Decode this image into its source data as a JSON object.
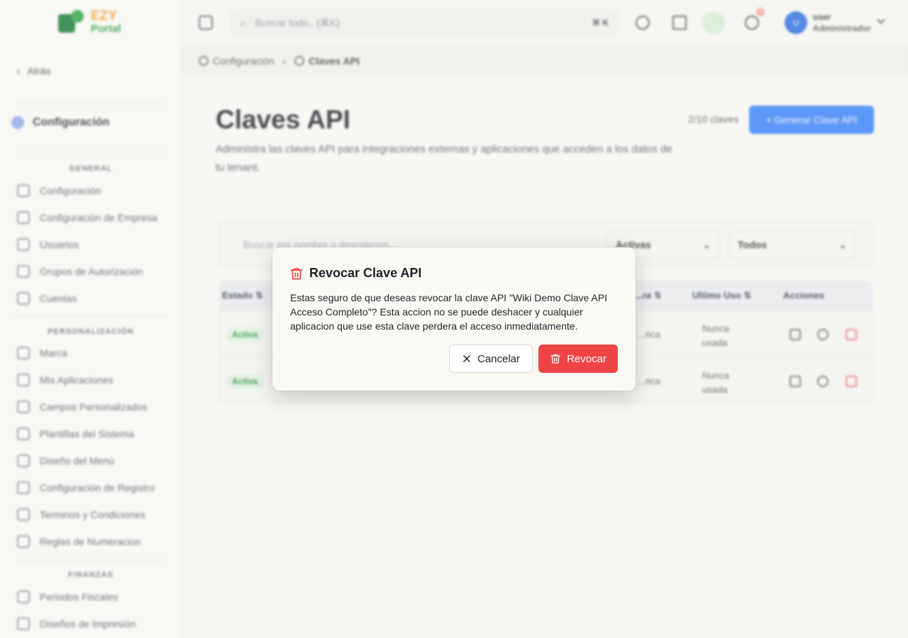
{
  "brand": {
    "line1": "EZY",
    "line2": "Portal"
  },
  "sidebar": {
    "back_label": "Atrás",
    "section_title": "Configuración",
    "groups": [
      {
        "label": "GENERAL",
        "items": [
          "Configuración",
          "Configuración de Empresa",
          "Usuarios",
          "Grupos de Autorización",
          "Cuentas"
        ]
      },
      {
        "label": "PERSONALIZACIÓN",
        "items": [
          "Marca",
          "Mis Aplicaciones",
          "Campos Personalizados",
          "Plantillas del Sistema",
          "Diseño del Menú",
          "Configuración de Registro",
          "Terminos y Condiciones",
          "Reglas de Numeracion"
        ]
      },
      {
        "label": "FINANZAS",
        "items": [
          "Periodos Fiscales",
          "Diseños de Impresión"
        ]
      }
    ]
  },
  "topbar": {
    "search_placeholder": "Buscar todo.. (⌘K)",
    "shortcut": "⌘ K",
    "notification_count": "2",
    "avatar_initial": "U",
    "user_name": "user",
    "user_role": "Administrador"
  },
  "breadcrumb": {
    "parent": "Configuración",
    "current": "Claves API"
  },
  "page": {
    "title": "Claves API",
    "description": "Administra las claves API para integraciones externas y aplicaciones que acceden a los datos de tu tenant.",
    "count": "2/10 claves",
    "generate_label": "+ Generar Clave API"
  },
  "filters": {
    "search_placeholder": "Buscar por nombre o descripcion...",
    "status": "Activas",
    "scope": "Todos"
  },
  "table": {
    "headers": [
      "Estado",
      "...ra",
      "Ultimo Uso",
      "Acciones"
    ],
    "rows": [
      {
        "status": "Activa",
        "expiry": "...nca",
        "last_use": "Nunca usada"
      },
      {
        "status": "Activa",
        "expiry": "...nca",
        "last_use": "Nunca usada"
      }
    ]
  },
  "modal": {
    "title": "Revocar Clave API",
    "body": "Estas seguro de que deseas revocar la clave API \"Wiki Demo Clave API Acceso Completo\"? Esta accion no se puede deshacer y cualquier aplicacion que use esta clave perdera el acceso inmediatamente.",
    "cancel_label": "Cancelar",
    "confirm_label": "Revocar",
    "danger_color": "#ef4444"
  }
}
